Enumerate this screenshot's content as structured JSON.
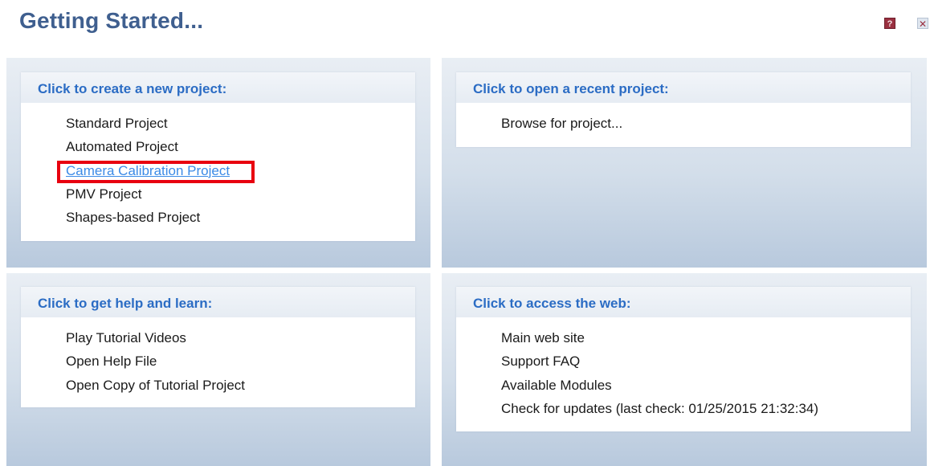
{
  "header": {
    "title": "Getting Started...",
    "help_icon": "?",
    "close_icon": "✕"
  },
  "new_project": {
    "heading": "Click to create a new project:",
    "items": [
      "Standard Project",
      "Automated Project",
      "Camera Calibration Project",
      "PMV Project",
      "Shapes-based Project"
    ]
  },
  "recent_project": {
    "heading": "Click to open a recent project:",
    "items": [
      "Browse for project..."
    ]
  },
  "help_learn": {
    "heading": "Click to get help and learn:",
    "items": [
      "Play Tutorial Videos",
      "Open Help File",
      "Open Copy of Tutorial Project"
    ]
  },
  "web": {
    "heading": "Click to access the web:",
    "items": [
      "Main web site",
      "Support FAQ",
      "Available Modules",
      "Check for updates (last check: 01/25/2015 21:32:34)"
    ]
  },
  "colors": {
    "title": "#3f5f8f",
    "heading": "#2b6cc4",
    "link": "#3b8ae6",
    "highlight": "#e8000f"
  }
}
